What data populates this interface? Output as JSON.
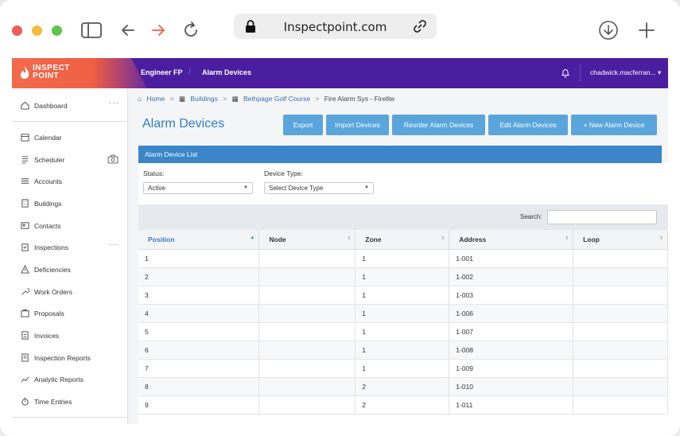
{
  "browser": {
    "url": "Inspectpoint.com"
  },
  "app": {
    "logo_line1": "INSPECT",
    "logo_line2": "POINT",
    "top_crumbs": [
      "Engineer FP",
      "Alarm Devices"
    ],
    "user": "chadwick.macferran... ▾"
  },
  "sidebar": {
    "items": [
      {
        "label": "Dashboard",
        "icon": "home-icon"
      },
      {
        "label": "Calendar",
        "icon": "calendar-icon"
      },
      {
        "label": "Scheduler",
        "icon": "scheduler-icon"
      },
      {
        "label": "Accounts",
        "icon": "list-icon"
      },
      {
        "label": "Buildings",
        "icon": "building-icon"
      },
      {
        "label": "Contacts",
        "icon": "contacts-icon"
      },
      {
        "label": "Inspections",
        "icon": "clipboard-icon"
      },
      {
        "label": "Deficiencies",
        "icon": "warning-icon"
      },
      {
        "label": "Work Orders",
        "icon": "wrench-icon"
      },
      {
        "label": "Proposals",
        "icon": "briefcase-icon"
      },
      {
        "label": "Invoices",
        "icon": "invoice-icon"
      },
      {
        "label": "Inspection Reports",
        "icon": "report-icon"
      },
      {
        "label": "Analytic Reports",
        "icon": "chart-icon"
      },
      {
        "label": "Time Entries",
        "icon": "stopwatch-icon"
      }
    ]
  },
  "breadcrumb": {
    "home": "Home",
    "buildings": "Buildings",
    "site": "Bethpage Golf Course",
    "current": "Fire Alarm Sys - Firelite"
  },
  "page": {
    "title": "Alarm Devices",
    "buttons": {
      "export": "Export",
      "import": "Import Devices",
      "reorder": "Reorder Alarm Devices",
      "edit": "Edit Alarm Devices",
      "new": "+ New Alarm Device"
    },
    "panel_title": "Alarm Device List",
    "filters": {
      "status_label": "Status:",
      "status_value": "Active",
      "type_label": "Device Type:",
      "type_value": "Select Device Type"
    },
    "search_label": "Search:"
  },
  "table": {
    "columns": [
      "Position",
      "Node",
      "Zone",
      "Address",
      "Loop"
    ],
    "rows": [
      [
        "1",
        "",
        "1",
        "1-001",
        ""
      ],
      [
        "2",
        "",
        "1",
        "1-002",
        ""
      ],
      [
        "3",
        "",
        "1",
        "1-003",
        ""
      ],
      [
        "4",
        "",
        "1",
        "1-006",
        ""
      ],
      [
        "5",
        "",
        "1",
        "1-007",
        ""
      ],
      [
        "6",
        "",
        "1",
        "1-008",
        ""
      ],
      [
        "7",
        "",
        "1",
        "1-009",
        ""
      ],
      [
        "8",
        "",
        "2",
        "1-010",
        ""
      ],
      [
        "9",
        "",
        "2",
        "1-011",
        ""
      ]
    ]
  }
}
